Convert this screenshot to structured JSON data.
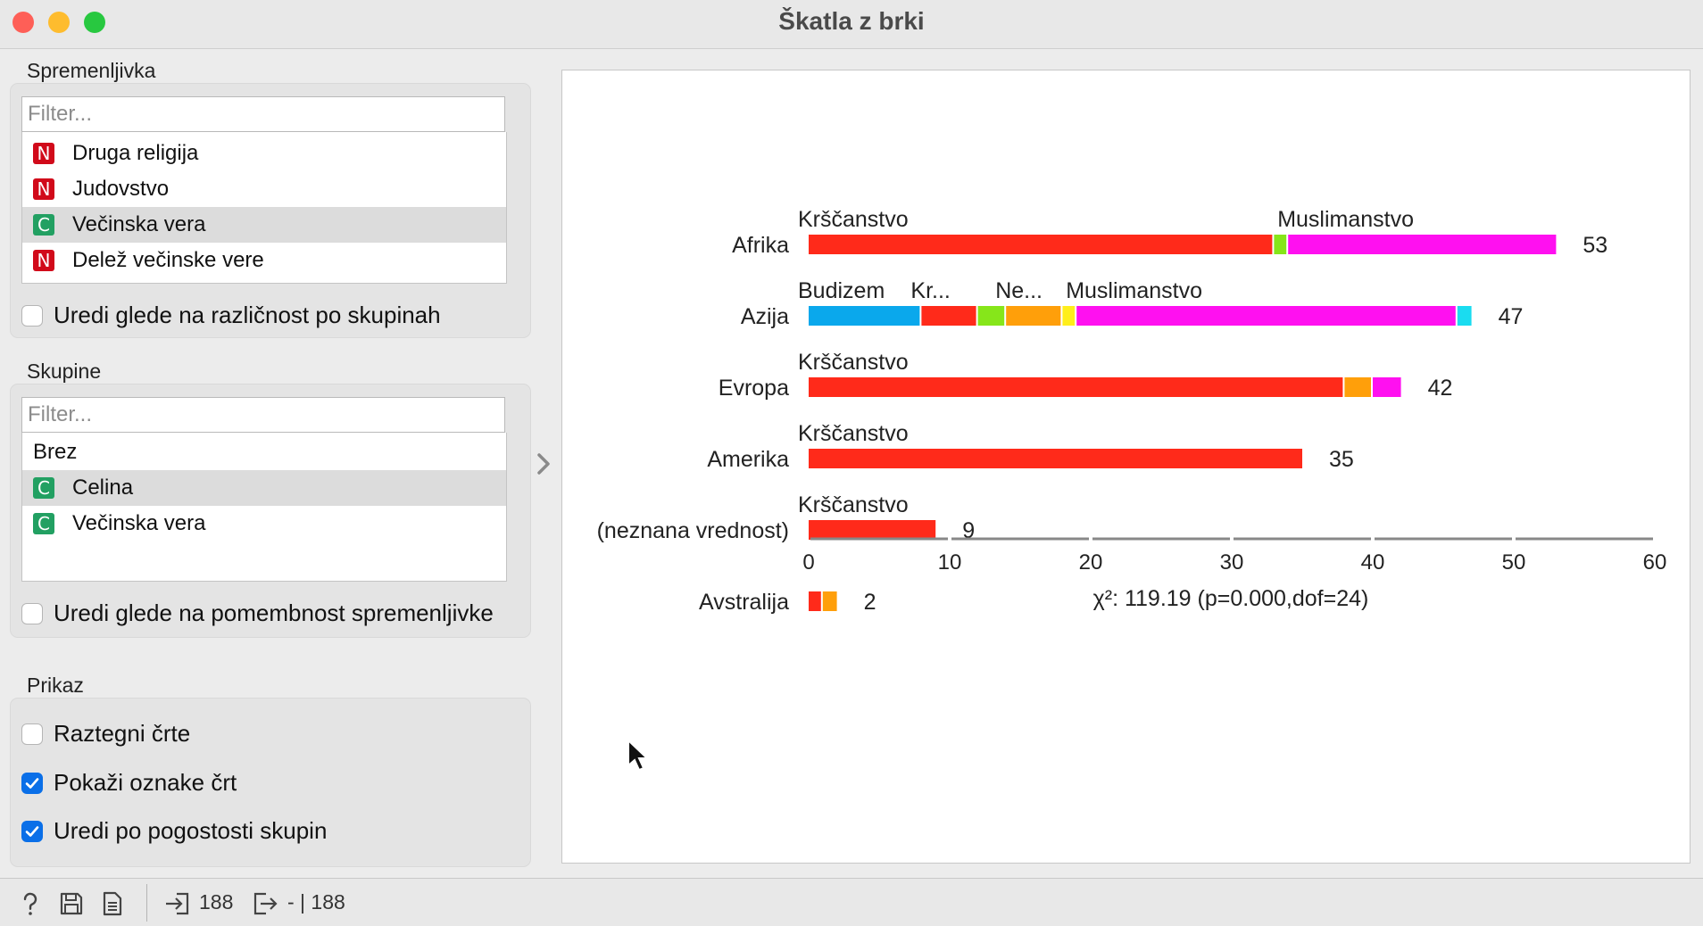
{
  "window": {
    "title": "Škatla z brki"
  },
  "variable_section": {
    "title": "Spremenljivka",
    "filter_placeholder": "Filter...",
    "items": [
      {
        "badge": "N",
        "label": "Druga religija",
        "selected": false
      },
      {
        "badge": "N",
        "label": "Judovstvo",
        "selected": false
      },
      {
        "badge": "C",
        "label": "Večinska vera",
        "selected": true
      },
      {
        "badge": "N",
        "label": "Delež večinske vere",
        "selected": false
      }
    ],
    "order_checkbox": {
      "label": "Uredi glede na različnost po skupinah",
      "checked": false
    }
  },
  "groups_section": {
    "title": "Skupine",
    "filter_placeholder": "Filter...",
    "items": [
      {
        "badge": "",
        "label": "Brez",
        "selected": false
      },
      {
        "badge": "C",
        "label": "Celina",
        "selected": true
      },
      {
        "badge": "C",
        "label": "Večinska vera",
        "selected": false
      }
    ],
    "order_checkbox": {
      "label": "Uredi glede na pomembnost spremenljivke",
      "checked": false
    }
  },
  "display_section": {
    "title": "Prikaz",
    "checkboxes": [
      {
        "label": "Raztegni črte",
        "checked": false
      },
      {
        "label": "Pokaži oznake črt",
        "checked": true
      },
      {
        "label": "Uredi po pogostosti skupin",
        "checked": true
      }
    ]
  },
  "status_bar": {
    "input_count": "188",
    "output_count": "- | 188"
  },
  "chart_data": {
    "type": "bar",
    "orientation": "horizontal",
    "stacked": true,
    "xlim": [
      0,
      60
    ],
    "xticks": [
      0,
      10,
      20,
      30,
      40,
      50,
      60
    ],
    "stat_label": "χ²: 119.19 (p=0.000,dof=24)",
    "colors": {
      "Budizem": "#0aa8ec",
      "Krščanstvo": "#ff2a1a",
      "Hinduizem": "#86e61a",
      "Neopredeljeno": "#ff9f0a",
      "Judovstvo": "#ffee1a",
      "Muslimanstvo": "#ff10f0",
      "Drugo": "#1adcf0"
    },
    "categories": [
      {
        "label": "Afrika",
        "total": "53",
        "segments": [
          {
            "value": 33,
            "color": "Krščanstvo"
          },
          {
            "value": 1,
            "color": "Hinduizem"
          },
          {
            "value": 19,
            "color": "Muslimanstvo"
          }
        ],
        "bar_labels": [
          "Krščanstvo",
          "",
          "Muslimanstvo"
        ]
      },
      {
        "label": "Azija",
        "total": "47",
        "segments": [
          {
            "value": 8,
            "color": "Budizem"
          },
          {
            "value": 4,
            "color": "Krščanstvo"
          },
          {
            "value": 2,
            "color": "Hinduizem"
          },
          {
            "value": 4,
            "color": "Neopredeljeno"
          },
          {
            "value": 1,
            "color": "Judovstvo"
          },
          {
            "value": 27,
            "color": "Muslimanstvo"
          },
          {
            "value": 1,
            "color": "Drugo"
          }
        ],
        "bar_labels": [
          "Budizem",
          "Kr...",
          "",
          "Ne...",
          "",
          "Muslimanstvo",
          ""
        ]
      },
      {
        "label": "Evropa",
        "total": "42",
        "segments": [
          {
            "value": 38,
            "color": "Krščanstvo"
          },
          {
            "value": 2,
            "color": "Neopredeljeno"
          },
          {
            "value": 2,
            "color": "Muslimanstvo"
          }
        ],
        "bar_labels": [
          "Krščanstvo",
          "",
          ""
        ]
      },
      {
        "label": "Amerika",
        "total": "35",
        "segments": [
          {
            "value": 35,
            "color": "Krščanstvo"
          }
        ],
        "bar_labels": [
          "Krščanstvo"
        ]
      },
      {
        "label": "(neznana vrednost)",
        "total": "9",
        "segments": [
          {
            "value": 9,
            "color": "Krščanstvo"
          }
        ],
        "bar_labels": [
          "Krščanstvo"
        ]
      },
      {
        "label": "Avstralija",
        "total": "2",
        "segments": [
          {
            "value": 1,
            "color": "Krščanstvo"
          },
          {
            "value": 1,
            "color": "Neopredeljeno"
          }
        ],
        "bar_labels": [
          "",
          ""
        ]
      }
    ]
  }
}
